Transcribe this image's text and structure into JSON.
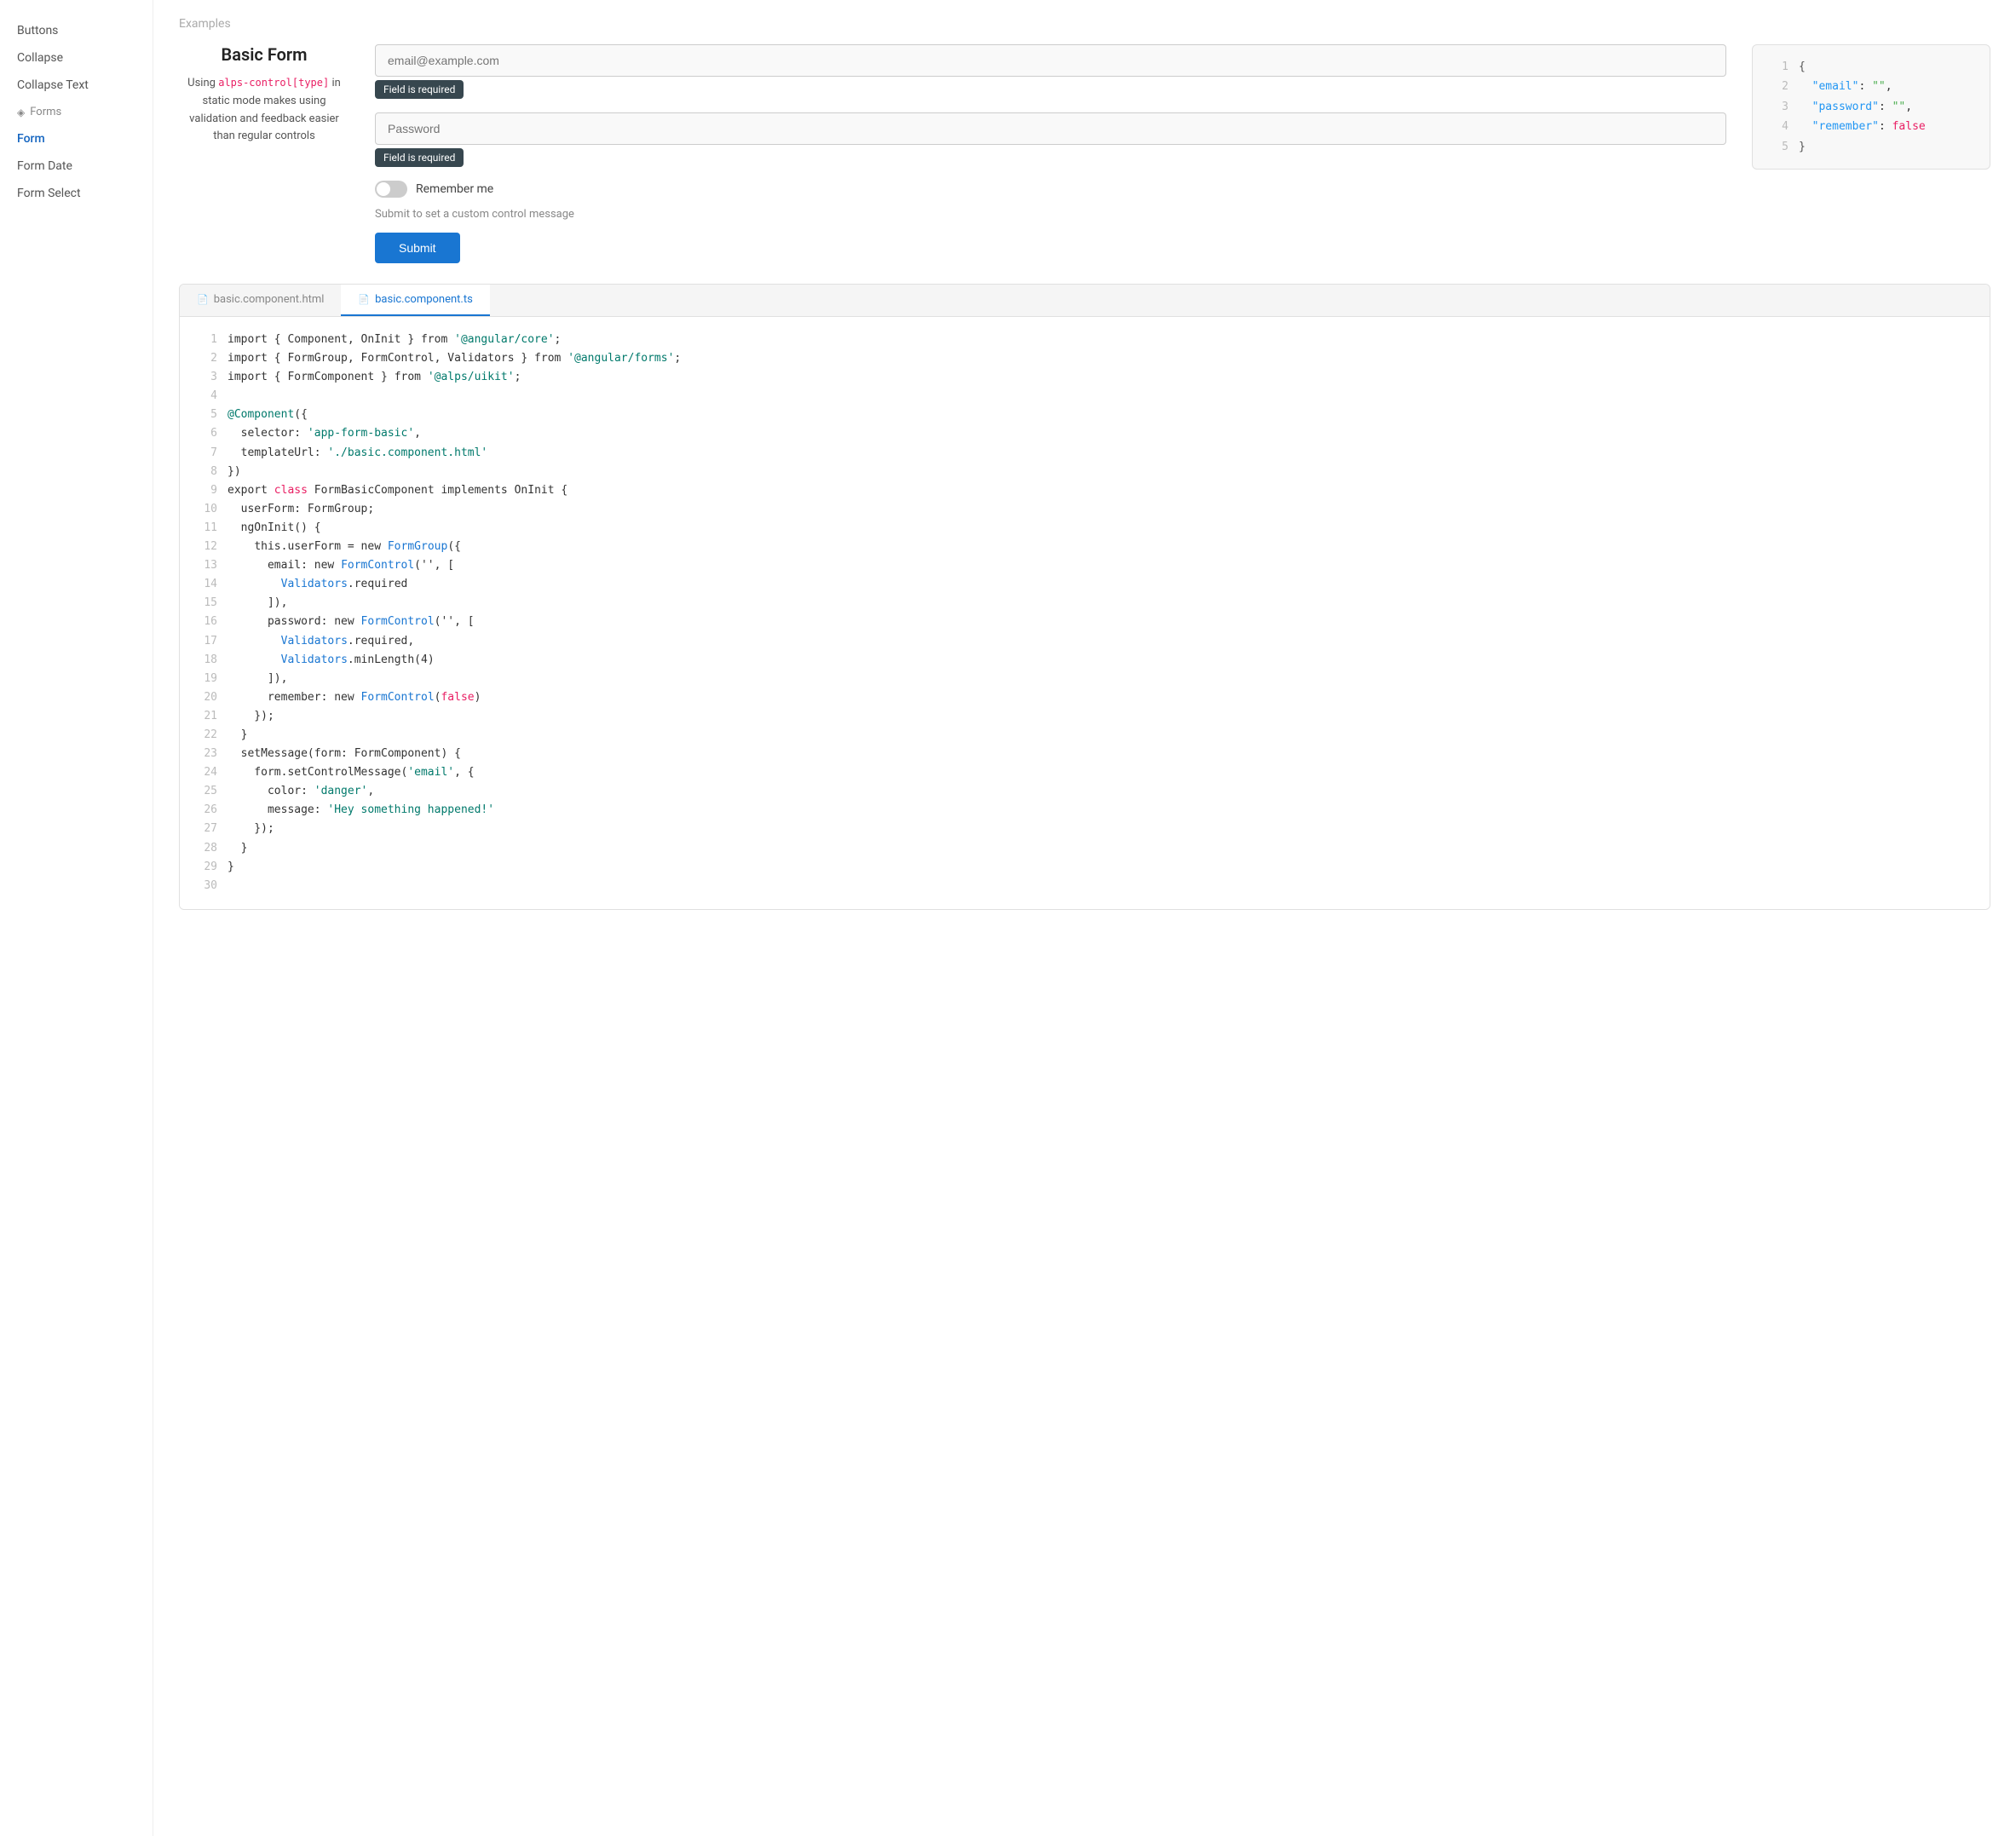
{
  "sidebar": {
    "items": [
      {
        "id": "buttons",
        "label": "Buttons",
        "active": false
      },
      {
        "id": "collapse",
        "label": "Collapse",
        "active": false
      },
      {
        "id": "collapse-text",
        "label": "Collapse Text",
        "active": false
      },
      {
        "id": "forms-section",
        "label": "Forms",
        "isSection": true,
        "icon": "◈"
      },
      {
        "id": "form",
        "label": "Form",
        "active": true
      },
      {
        "id": "form-date",
        "label": "Form Date",
        "active": false
      },
      {
        "id": "form-select",
        "label": "Form Select",
        "active": false
      }
    ]
  },
  "header": {
    "examples_label": "Examples"
  },
  "left_panel": {
    "title": "Basic Form",
    "description_pre": "Using ",
    "highlight": "alps-control[type]",
    "description_post": " in static mode makes using validation and feedback easier than regular controls"
  },
  "form": {
    "email_placeholder": "email@example.com",
    "password_placeholder": "Password",
    "error_required": "Field is required",
    "remember_label": "Remember me",
    "submit_hint": "Submit to set a custom control message",
    "submit_label": "Submit"
  },
  "json_panel": {
    "lines": [
      {
        "num": 1,
        "content": "{"
      },
      {
        "num": 2,
        "content": "  \"email\": \"\","
      },
      {
        "num": 3,
        "content": "  \"password\": \"\","
      },
      {
        "num": 4,
        "content": "  \"remember\": false"
      },
      {
        "num": 5,
        "content": "}"
      }
    ]
  },
  "code_tabs": [
    {
      "id": "html",
      "label": "basic.component.html",
      "active": false
    },
    {
      "id": "ts",
      "label": "basic.component.ts",
      "active": true
    }
  ],
  "code_lines": [
    {
      "num": 1,
      "text": "import { Component, OnInit } from '@angular/core';"
    },
    {
      "num": 2,
      "text": "import { FormGroup, FormControl, Validators } from '@angular/forms';"
    },
    {
      "num": 3,
      "text": "import { FormComponent } from '@alps/uikit';"
    },
    {
      "num": 4,
      "text": ""
    },
    {
      "num": 5,
      "text": "@Component({"
    },
    {
      "num": 6,
      "text": "  selector: 'app-form-basic',"
    },
    {
      "num": 7,
      "text": "  templateUrl: './basic.component.html'"
    },
    {
      "num": 8,
      "text": "})"
    },
    {
      "num": 9,
      "text": "export class FormBasicComponent implements OnInit {"
    },
    {
      "num": 10,
      "text": "  userForm: FormGroup;"
    },
    {
      "num": 11,
      "text": "  ngOnInit() {"
    },
    {
      "num": 12,
      "text": "    this.userForm = new FormGroup({"
    },
    {
      "num": 13,
      "text": "      email: new FormControl('', ["
    },
    {
      "num": 14,
      "text": "        Validators.required"
    },
    {
      "num": 15,
      "text": "      ]),"
    },
    {
      "num": 16,
      "text": "      password: new FormControl('', ["
    },
    {
      "num": 17,
      "text": "        Validators.required,"
    },
    {
      "num": 18,
      "text": "        Validators.minLength(4)"
    },
    {
      "num": 19,
      "text": "      ]),"
    },
    {
      "num": 20,
      "text": "      remember: new FormControl(false)"
    },
    {
      "num": 21,
      "text": "    });"
    },
    {
      "num": 22,
      "text": "  }"
    },
    {
      "num": 23,
      "text": "  setMessage(form: FormComponent) {"
    },
    {
      "num": 24,
      "text": "    form.setControlMessage('email', {"
    },
    {
      "num": 25,
      "text": "      color: 'danger',"
    },
    {
      "num": 26,
      "text": "      message: 'Hey something happened!'"
    },
    {
      "num": 27,
      "text": "    });"
    },
    {
      "num": 28,
      "text": "  }"
    },
    {
      "num": 29,
      "text": "}"
    },
    {
      "num": 30,
      "text": ""
    }
  ]
}
